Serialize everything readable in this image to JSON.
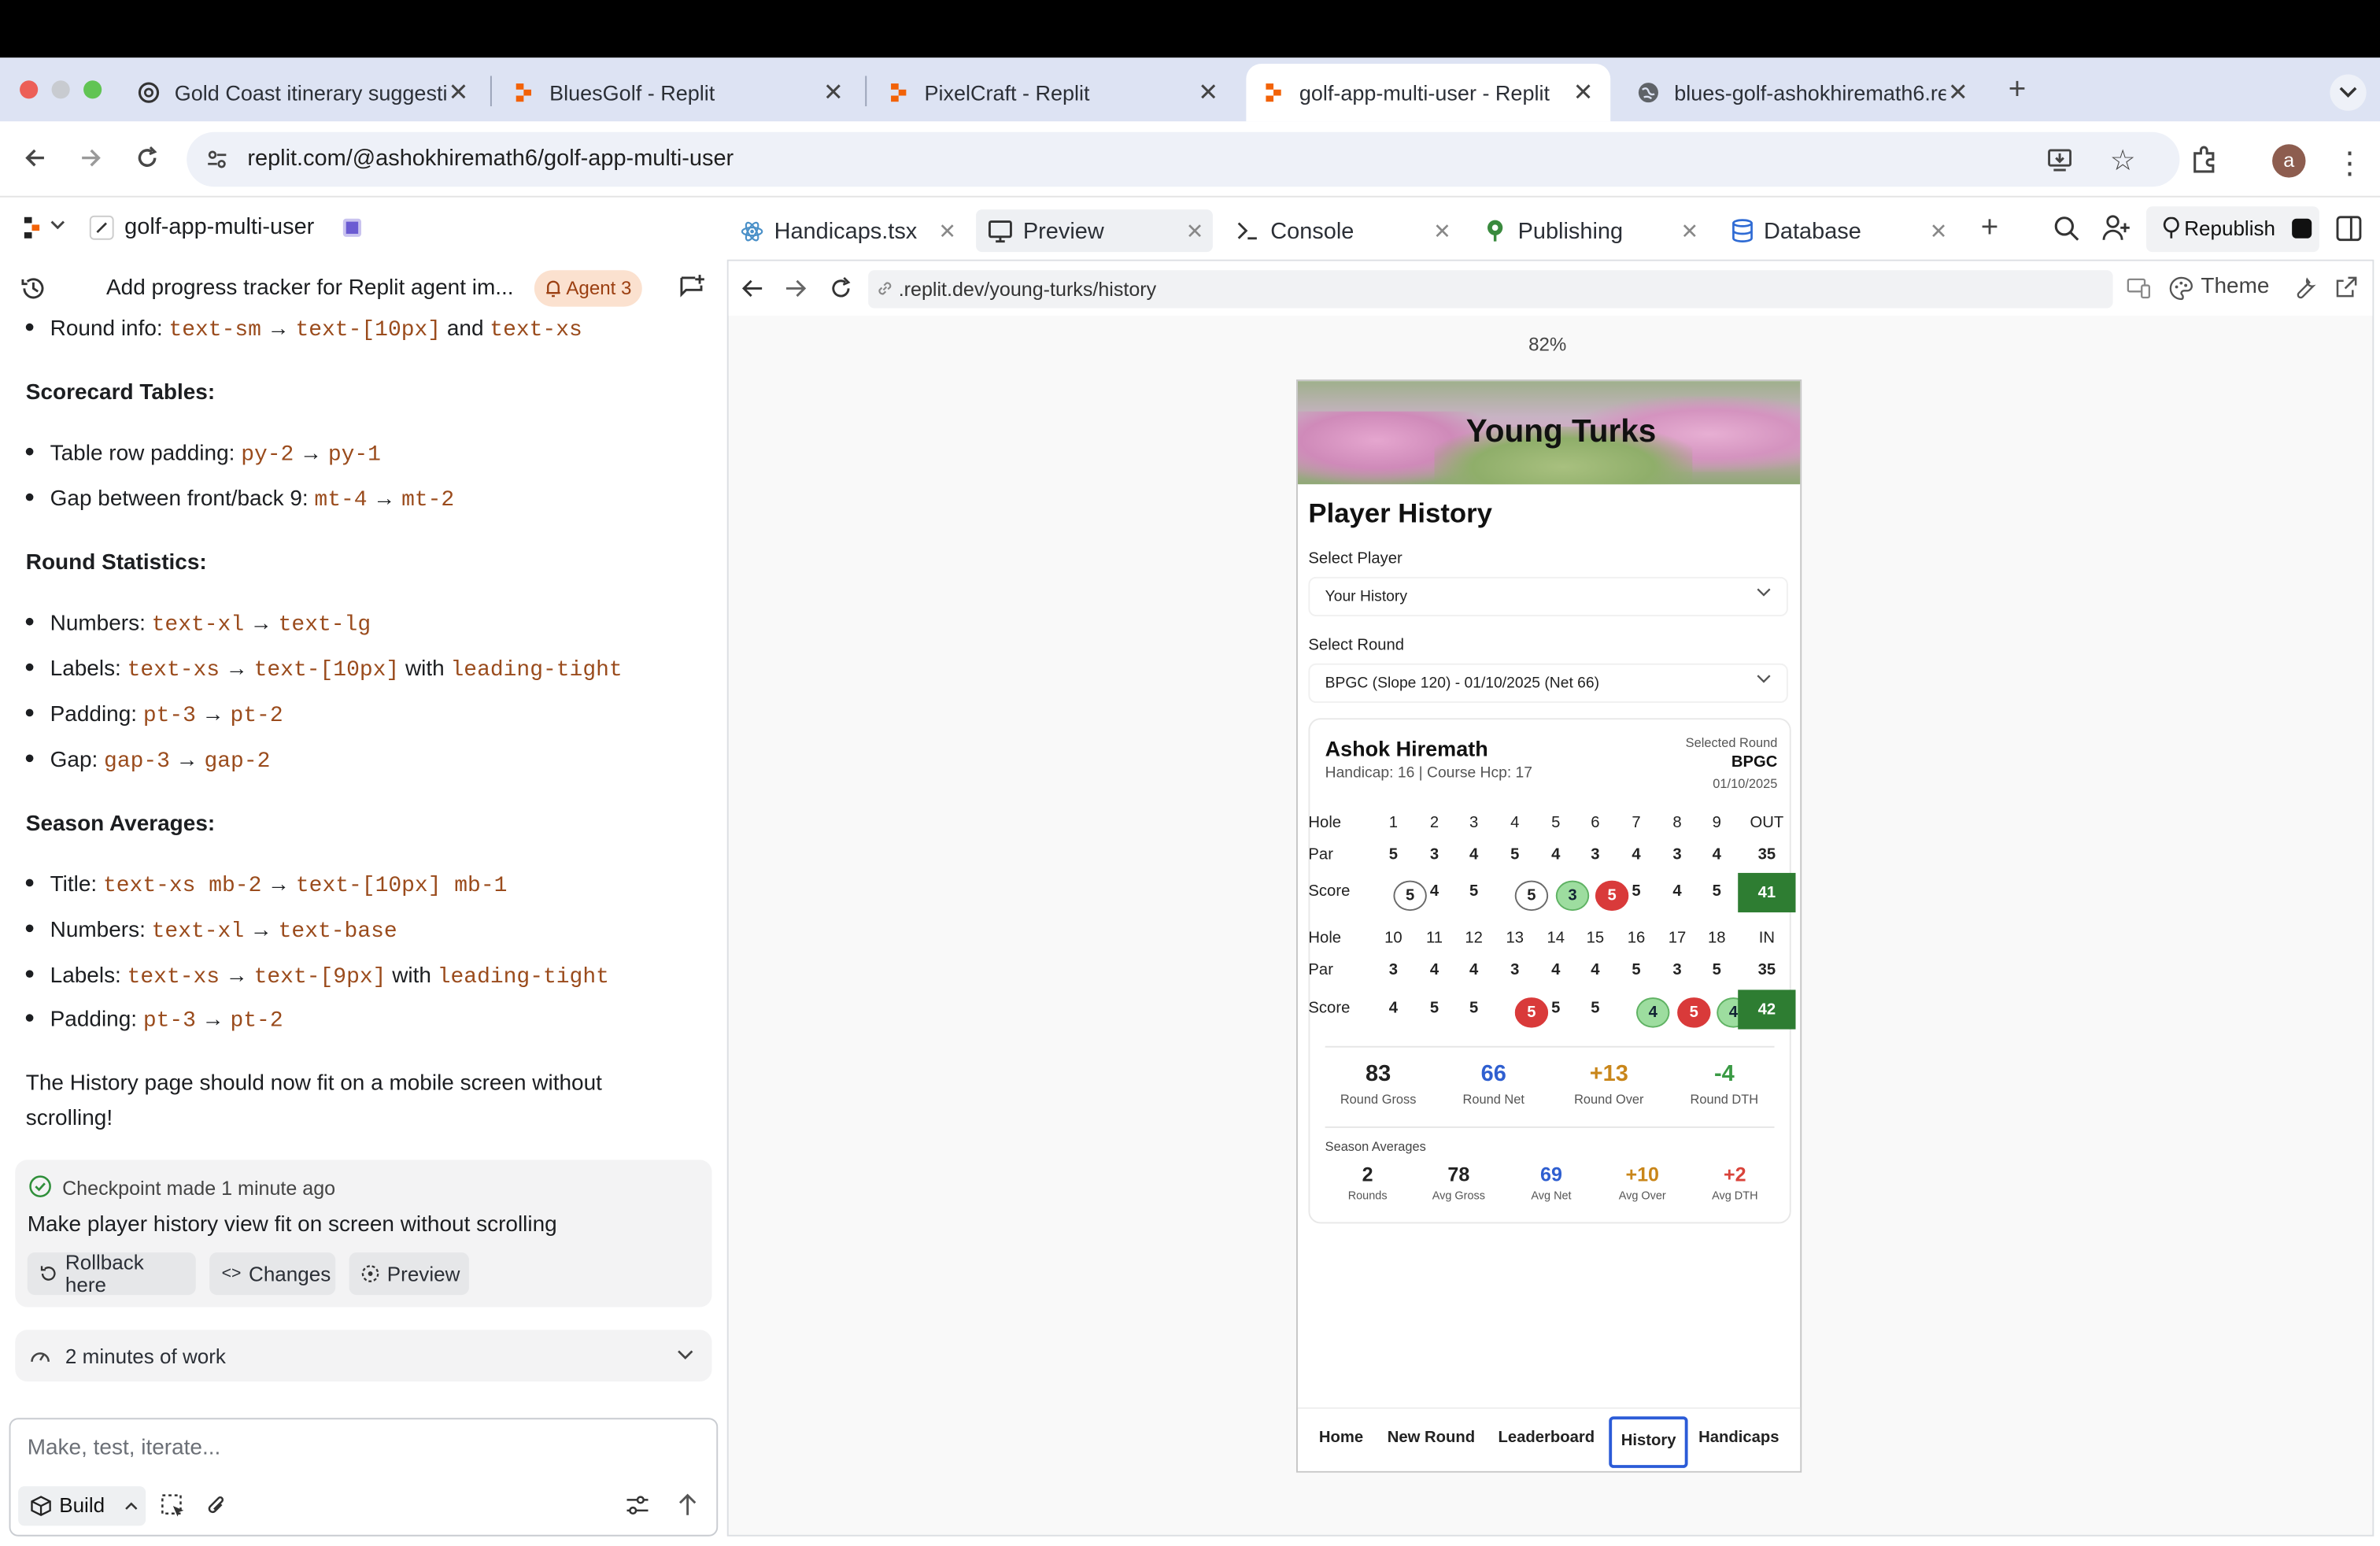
{
  "browser": {
    "tabs": [
      {
        "title": "Gold Coast itinerary suggestio",
        "icon": "chatgpt-icon"
      },
      {
        "title": "BluesGolf - Replit",
        "icon": "replit-icon"
      },
      {
        "title": "PixelCraft - Replit",
        "icon": "replit-icon"
      },
      {
        "title": "golf-app-multi-user - Replit",
        "icon": "replit-icon"
      },
      {
        "title": "blues-golf-ashokhiremath6.re",
        "icon": "globe-icon"
      }
    ],
    "url": "replit.com/@ashokhiremath6/golf-app-multi-user",
    "avatar_letter": "a"
  },
  "workspace": {
    "project_name": "golf-app-multi-user",
    "tabs": [
      {
        "label": "Handicaps.tsx"
      },
      {
        "label": "Preview"
      },
      {
        "label": "Console"
      },
      {
        "label": "Publishing"
      },
      {
        "label": "Database"
      }
    ],
    "republish_label": "Republish"
  },
  "chat": {
    "header_title": "Add progress tracker for Replit agent im...",
    "agent_badge": "Agent 3",
    "lines": {
      "round_info_label": "Round info:",
      "round_info_a": "text-sm",
      "round_info_b": "text-[10px]",
      "round_info_and": "and",
      "round_info_c": "text-xs",
      "scorecard_heading": "Scorecard Tables:",
      "table_row_label": "Table row padding:",
      "table_row_a": "py-2",
      "table_row_b": "py-1",
      "gap_back9_label": "Gap between front/back 9:",
      "gap_back9_a": "mt-4",
      "gap_back9_b": "mt-2",
      "roundstats_heading": "Round Statistics:",
      "rs_numbers_label": "Numbers:",
      "rs_numbers_a": "text-xl",
      "rs_numbers_b": "text-lg",
      "rs_labels_label": "Labels:",
      "rs_labels_a": "text-xs",
      "rs_labels_b": "text-[10px]",
      "rs_labels_with": "with",
      "rs_labels_c": "leading-tight",
      "rs_padding_label": "Padding:",
      "rs_padding_a": "pt-3",
      "rs_padding_b": "pt-2",
      "rs_gap_label": "Gap:",
      "rs_gap_a": "gap-3",
      "rs_gap_b": "gap-2",
      "season_heading": "Season Averages:",
      "sa_title_label": "Title:",
      "sa_title_a": "text-xs mb-2",
      "sa_title_b": "text-[10px] mb-1",
      "sa_numbers_label": "Numbers:",
      "sa_numbers_a": "text-xl",
      "sa_numbers_b": "text-base",
      "sa_labels_label": "Labels:",
      "sa_labels_a": "text-xs",
      "sa_labels_b": "text-[9px]",
      "sa_labels_with": "with",
      "sa_labels_c": "leading-tight",
      "sa_padding_label": "Padding:",
      "sa_padding_a": "pt-3",
      "sa_padding_b": "pt-2",
      "conclusion_1": "The History page should now fit on a mobile screen without",
      "conclusion_2": "scrolling!"
    },
    "checkpoint": {
      "status": "Checkpoint made 1 minute ago",
      "message": "Make player history view fit on screen without scrolling",
      "rollback": "Rollback here",
      "changes": "Changes",
      "preview": "Preview"
    },
    "work_summary": "2 minutes of work",
    "input_placeholder": "Make, test, iterate...",
    "build_label": "Build"
  },
  "preview": {
    "url": ".replit.dev/young-turks/history",
    "theme_label": "Theme",
    "zoom": "82%",
    "app": {
      "header_title": "Young Turks",
      "page_title": "Player History",
      "select_player_label": "Select Player",
      "select_player_value": "Your History",
      "select_round_label": "Select Round",
      "select_round_value": "BPGC (Slope 120) - 01/10/2025 (Net 66)",
      "player_name": "Ashok Hiremath",
      "player_sub": "Handicap: 16 | Course Hcp: 17",
      "selected_round_label": "Selected Round",
      "selected_round_course": "BPGC",
      "selected_round_date": "01/10/2025",
      "front": {
        "hole_label": "Hole",
        "holes": [
          "1",
          "2",
          "3",
          "4",
          "5",
          "6",
          "7",
          "8",
          "9"
        ],
        "total_header": "OUT",
        "par_label": "Par",
        "pars": [
          "5",
          "3",
          "4",
          "5",
          "4",
          "3",
          "4",
          "3",
          "4"
        ],
        "par_total": "35",
        "score_label": "Score",
        "scores": [
          "5",
          "4",
          "5",
          "5",
          "3",
          "5",
          "5",
          "4",
          "5"
        ],
        "score_total": "41"
      },
      "back": {
        "hole_label": "Hole",
        "holes": [
          "10",
          "11",
          "12",
          "13",
          "14",
          "15",
          "16",
          "17",
          "18"
        ],
        "total_header": "IN",
        "par_label": "Par",
        "pars": [
          "3",
          "4",
          "4",
          "3",
          "4",
          "4",
          "5",
          "3",
          "5"
        ],
        "par_total": "35",
        "score_label": "Score",
        "scores": [
          "4",
          "5",
          "5",
          "5",
          "5",
          "5",
          "4",
          "5",
          "4"
        ],
        "score_total": "42"
      },
      "round_stats": [
        {
          "value": "83",
          "label": "Round Gross",
          "color": "#222222"
        },
        {
          "value": "66",
          "label": "Round Net",
          "color": "#2f5fd0"
        },
        {
          "value": "+13",
          "label": "Round Over",
          "color": "#c9861a"
        },
        {
          "value": "-4",
          "label": "Round DTH",
          "color": "#3a9a44"
        }
      ],
      "season_title": "Season Averages",
      "season_stats": [
        {
          "value": "2",
          "label": "Rounds",
          "color": "#222222"
        },
        {
          "value": "78",
          "label": "Avg Gross",
          "color": "#222222"
        },
        {
          "value": "69",
          "label": "Avg Net",
          "color": "#2f5fd0"
        },
        {
          "value": "+10",
          "label": "Avg Over",
          "color": "#c9861a"
        },
        {
          "value": "+2",
          "label": "Avg DTH",
          "color": "#d9433a"
        }
      ],
      "nav": {
        "home": "Home",
        "new_round": "New Round",
        "leaderboard": "Leaderboard",
        "history": "History",
        "handicaps": "Handicaps"
      }
    }
  }
}
